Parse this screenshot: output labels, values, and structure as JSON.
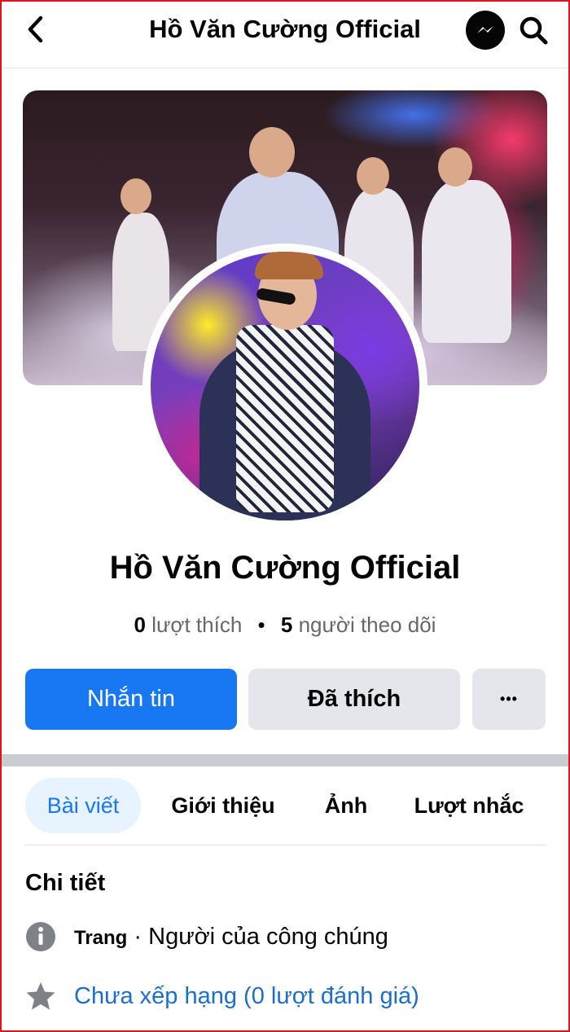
{
  "header": {
    "title": "Hồ Văn Cường Official",
    "back_icon": "chevron-left-icon",
    "messenger_icon": "messenger-icon",
    "search_icon": "search-icon"
  },
  "profile": {
    "name": "Hồ Văn Cường Official",
    "likes_count": "0",
    "likes_label": "lượt thích",
    "separator": "•",
    "followers_count": "5",
    "followers_label": "người theo dõi"
  },
  "actions": {
    "message_label": "Nhắn tin",
    "liked_label": "Đã thích",
    "more_label": "•••"
  },
  "tabs": [
    {
      "label": "Bài viết",
      "active": true
    },
    {
      "label": "Giới thiệu",
      "active": false
    },
    {
      "label": "Ảnh",
      "active": false
    },
    {
      "label": "Lượt nhắc",
      "active": false
    }
  ],
  "details": {
    "title": "Chi tiết",
    "category_prefix": "Trang",
    "category_separator": " · ",
    "category": "Người của công chúng",
    "rating": "Chưa xếp hạng (0 lượt đánh giá)"
  },
  "colors": {
    "accent": "#1877f2",
    "link": "#1a6fce",
    "secondary_text": "#65676b",
    "button_gray": "#e4e6eb",
    "frame_border": "#e0141e"
  }
}
